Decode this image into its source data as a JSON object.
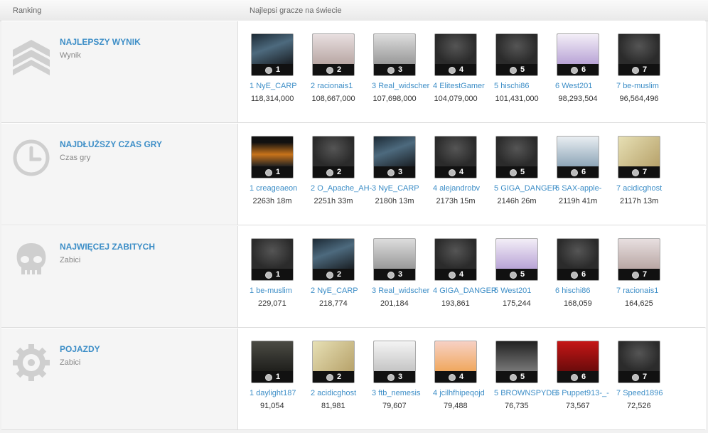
{
  "header": {
    "ranking": "Ranking",
    "best_players": "Najlepsi gracze na świecie"
  },
  "categories": [
    {
      "title": "NAJLEPSZY WYNIK",
      "subtitle": "Wynik",
      "icon": "chevron-rank-icon",
      "players": [
        {
          "rank": "1",
          "num": "1",
          "name": "NyE_CARP",
          "value": "118,314,000",
          "pic": "gun"
        },
        {
          "rank": "2",
          "num": "2",
          "name": "racionais1",
          "value": "108,667,000",
          "pic": "photo"
        },
        {
          "rank": "3",
          "num": "3",
          "name": "Real_widscher",
          "value": "107,698,000",
          "pic": "group"
        },
        {
          "rank": "4",
          "num": "4",
          "name": "ElitestGamer",
          "value": "104,079,000",
          "pic": "dark"
        },
        {
          "rank": "5",
          "num": "5",
          "name": "hischi86",
          "value": "101,431,000",
          "pic": "dark"
        },
        {
          "rank": "6",
          "num": "6",
          "name": "West201",
          "value": "98,293,504",
          "pic": "anime"
        },
        {
          "rank": "7",
          "num": "7",
          "name": "be-muslim",
          "value": "96,564,496",
          "pic": "dark"
        }
      ]
    },
    {
      "title": "NAJDŁUŻSZY CZAS GRY",
      "subtitle": "Czas gry",
      "icon": "clock-icon",
      "players": [
        {
          "rank": "1",
          "num": "1",
          "name": "creageaeon",
          "value": "2263h 18m",
          "pic": "fire"
        },
        {
          "rank": "2",
          "num": "2",
          "name": "O_Apache_AH-",
          "value": "2251h 33m",
          "pic": "dark"
        },
        {
          "rank": "3",
          "num": "3",
          "name": "NyE_CARP",
          "value": "2180h 13m",
          "pic": "gun"
        },
        {
          "rank": "4",
          "num": "4",
          "name": "alejandrobv",
          "value": "2173h 15m",
          "pic": "dark"
        },
        {
          "rank": "5",
          "num": "5",
          "name": "GIGA_DANGER",
          "value": "2146h 26m",
          "pic": "dark"
        },
        {
          "rank": "6",
          "num": "6",
          "name": "SAX-apple-",
          "value": "2119h 41m",
          "pic": "heli"
        },
        {
          "rank": "7",
          "num": "7",
          "name": "acidicghost",
          "value": "2117h 13m",
          "pic": "gold"
        }
      ]
    },
    {
      "title": "NAJWIĘCEJ ZABITYCH",
      "subtitle": "Zabici",
      "icon": "skull-icon",
      "players": [
        {
          "rank": "1",
          "num": "1",
          "name": "be-muslim",
          "value": "229,071",
          "pic": "dark"
        },
        {
          "rank": "2",
          "num": "2",
          "name": "NyE_CARP",
          "value": "218,774",
          "pic": "gun"
        },
        {
          "rank": "3",
          "num": "3",
          "name": "Real_widscher",
          "value": "201,184",
          "pic": "group"
        },
        {
          "rank": "4",
          "num": "4",
          "name": "GIGA_DANGER",
          "value": "193,861",
          "pic": "dark"
        },
        {
          "rank": "5",
          "num": "5",
          "name": "West201",
          "value": "175,244",
          "pic": "anime"
        },
        {
          "rank": "6",
          "num": "6",
          "name": "hischi86",
          "value": "168,059",
          "pic": "dark"
        },
        {
          "rank": "7",
          "num": "7",
          "name": "racionais1",
          "value": "164,625",
          "pic": "photo"
        }
      ]
    },
    {
      "title": "POJAZDY",
      "subtitle": "Zabici",
      "icon": "gear-icon",
      "players": [
        {
          "rank": "1",
          "num": "1",
          "name": "daylight187",
          "value": "91,054",
          "pic": "war"
        },
        {
          "rank": "2",
          "num": "2",
          "name": "acidicghost",
          "value": "81,981",
          "pic": "gold"
        },
        {
          "rank": "3",
          "num": "3",
          "name": "ftb_nemesis",
          "value": "79,607",
          "pic": "tank"
        },
        {
          "rank": "4",
          "num": "4",
          "name": "jcilhfhipeqojd",
          "value": "79,488",
          "pic": "cartoon"
        },
        {
          "rank": "5",
          "num": "5",
          "name": "BROWNSPYDEI",
          "value": "76,735",
          "pic": "heli2"
        },
        {
          "rank": "6",
          "num": "6",
          "name": "Puppet913-_-",
          "value": "73,567",
          "pic": "red"
        },
        {
          "rank": "7",
          "num": "7",
          "name": "Speed1896",
          "value": "72,526",
          "pic": "dark"
        }
      ]
    }
  ]
}
